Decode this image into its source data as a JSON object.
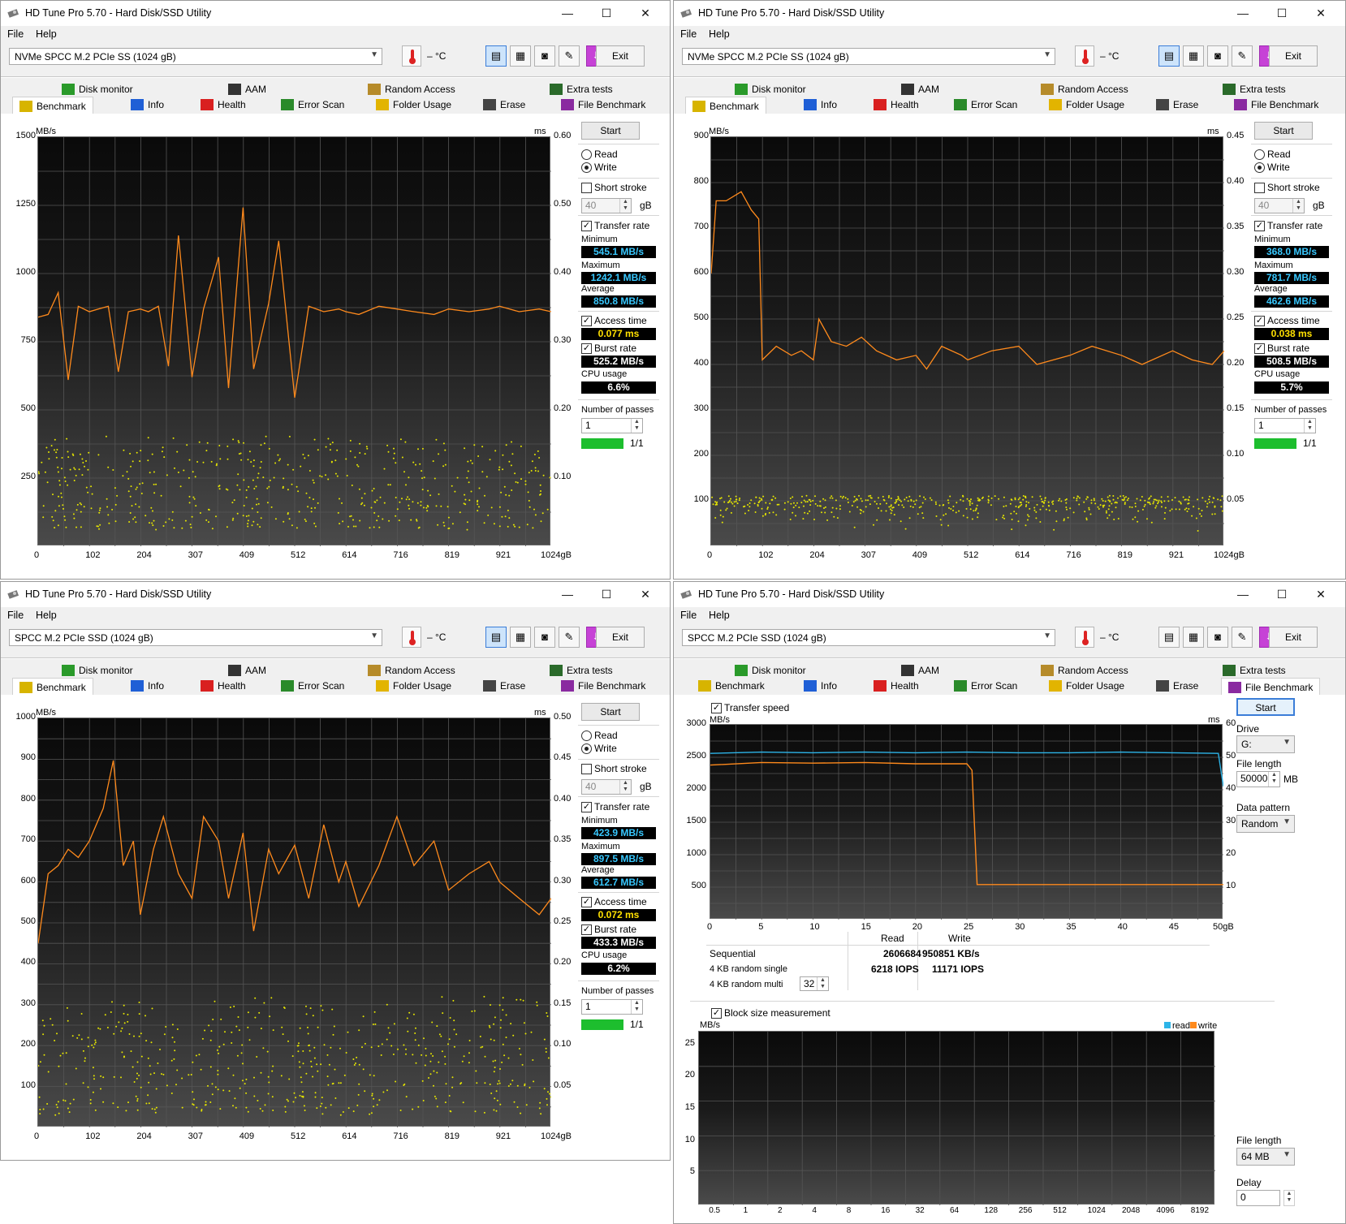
{
  "windows": [
    {
      "title": "HD Tune Pro 5.70 - Hard Disk/SSD Utility",
      "menu": [
        "File",
        "Help"
      ],
      "drive": "NVMe   SPCC M.2 PCIe SS (1024 gB)",
      "temp": "– °C",
      "exit": "Exit",
      "tabs_row1": [
        "Disk monitor",
        "AAM",
        "Random Access",
        "Extra tests"
      ],
      "tabs_row2": [
        "Benchmark",
        "Info",
        "Health",
        "Error Scan",
        "Folder Usage",
        "Erase",
        "File Benchmark"
      ],
      "active_tab": "Benchmark",
      "start": "Start",
      "read": "Read",
      "write": "Write",
      "mode": "write",
      "short_stroke": "Short stroke",
      "stroke_value": "40",
      "stroke_unit": "gB",
      "transfer_rate": "Transfer rate",
      "minimum_label": "Minimum",
      "minimum": "545.1 MB/s",
      "maximum_label": "Maximum",
      "maximum": "1242.1 MB/s",
      "average_label": "Average",
      "average": "850.8 MB/s",
      "access_time_label": "Access time",
      "access_time": "0.077 ms",
      "burst_rate_label": "Burst rate",
      "burst_rate": "525.2 MB/s",
      "cpu_usage_label": "CPU usage",
      "cpu_usage": "6.6%",
      "passes_label": "Number of passes",
      "passes": "1",
      "pass_progress": "1/1",
      "y_unit": "MB/s",
      "y2_unit": "ms",
      "y_ticks": [
        "1500",
        "1250",
        "1000",
        "750",
        "500",
        "250"
      ],
      "y2_ticks": [
        "0.60",
        "0.50",
        "0.40",
        "0.30",
        "0.20",
        "0.10"
      ],
      "x_ticks": [
        "0",
        "102",
        "204",
        "307",
        "409",
        "512",
        "614",
        "716",
        "819",
        "921",
        "1024gB"
      ]
    },
    {
      "title": "HD Tune Pro 5.70 - Hard Disk/SSD Utility",
      "menu": [
        "File",
        "Help"
      ],
      "drive": "NVMe   SPCC M.2 PCIe SS (1024 gB)",
      "temp": "– °C",
      "exit": "Exit",
      "tabs_row1": [
        "Disk monitor",
        "AAM",
        "Random Access",
        "Extra tests"
      ],
      "tabs_row2": [
        "Benchmark",
        "Info",
        "Health",
        "Error Scan",
        "Folder Usage",
        "Erase",
        "File Benchmark"
      ],
      "active_tab": "Benchmark",
      "start": "Start",
      "read": "Read",
      "write": "Write",
      "mode": "write",
      "short_stroke": "Short stroke",
      "stroke_value": "40",
      "stroke_unit": "gB",
      "transfer_rate": "Transfer rate",
      "minimum_label": "Minimum",
      "minimum": "368.0 MB/s",
      "maximum_label": "Maximum",
      "maximum": "781.7 MB/s",
      "average_label": "Average",
      "average": "462.6 MB/s",
      "access_time_label": "Access time",
      "access_time": "0.038 ms",
      "burst_rate_label": "Burst rate",
      "burst_rate": "508.5 MB/s",
      "cpu_usage_label": "CPU usage",
      "cpu_usage": "5.7%",
      "passes_label": "Number of passes",
      "passes": "1",
      "pass_progress": "1/1",
      "y_unit": "MB/s",
      "y2_unit": "ms",
      "y_ticks": [
        "900",
        "800",
        "700",
        "600",
        "500",
        "400",
        "300",
        "200",
        "100"
      ],
      "y2_ticks": [
        "0.45",
        "0.40",
        "0.35",
        "0.30",
        "0.25",
        "0.20",
        "0.15",
        "0.10",
        "0.05"
      ],
      "x_ticks": [
        "0",
        "102",
        "204",
        "307",
        "409",
        "512",
        "614",
        "716",
        "819",
        "921",
        "1024gB"
      ]
    },
    {
      "title": "HD Tune Pro 5.70 - Hard Disk/SSD Utility",
      "menu": [
        "File",
        "Help"
      ],
      "drive": "SPCC M.2 PCIe SSD (1024 gB)",
      "temp": "– °C",
      "exit": "Exit",
      "tabs_row1": [
        "Disk monitor",
        "AAM",
        "Random Access",
        "Extra tests"
      ],
      "tabs_row2": [
        "Benchmark",
        "Info",
        "Health",
        "Error Scan",
        "Folder Usage",
        "Erase",
        "File Benchmark"
      ],
      "active_tab": "Benchmark",
      "start": "Start",
      "read": "Read",
      "write": "Write",
      "mode": "write",
      "short_stroke": "Short stroke",
      "stroke_value": "40",
      "stroke_unit": "gB",
      "transfer_rate": "Transfer rate",
      "minimum_label": "Minimum",
      "minimum": "423.9 MB/s",
      "maximum_label": "Maximum",
      "maximum": "897.5 MB/s",
      "average_label": "Average",
      "average": "612.7 MB/s",
      "access_time_label": "Access time",
      "access_time": "0.072 ms",
      "burst_rate_label": "Burst rate",
      "burst_rate": "433.3 MB/s",
      "cpu_usage_label": "CPU usage",
      "cpu_usage": "6.2%",
      "passes_label": "Number of passes",
      "passes": "1",
      "pass_progress": "1/1",
      "y_unit": "MB/s",
      "y2_unit": "ms",
      "y_ticks": [
        "1000",
        "900",
        "800",
        "700",
        "600",
        "500",
        "400",
        "300",
        "200",
        "100"
      ],
      "y2_ticks": [
        "0.50",
        "0.45",
        "0.40",
        "0.35",
        "0.30",
        "0.25",
        "0.20",
        "0.15",
        "0.10",
        "0.05"
      ],
      "x_ticks": [
        "0",
        "102",
        "204",
        "307",
        "409",
        "512",
        "614",
        "716",
        "819",
        "921",
        "1024gB"
      ]
    },
    {
      "title": "HD Tune Pro 5.70 - Hard Disk/SSD Utility",
      "menu": [
        "File",
        "Help"
      ],
      "drive": "SPCC M.2 PCIe SSD (1024 gB)",
      "temp": "– °C",
      "exit": "Exit",
      "tabs_row1": [
        "Disk monitor",
        "AAM",
        "Random Access",
        "Extra tests"
      ],
      "tabs_row2": [
        "Benchmark",
        "Info",
        "Health",
        "Error Scan",
        "Folder Usage",
        "Erase",
        "File Benchmark"
      ],
      "active_tab": "File Benchmark",
      "start": "Start",
      "transfer_speed": "Transfer speed",
      "y_unit": "MB/s",
      "y2_unit": "ms",
      "y_ticks": [
        "3000",
        "2500",
        "2000",
        "1500",
        "1000",
        "500"
      ],
      "y2_ticks": [
        "60",
        "50",
        "40",
        "30",
        "20",
        "10"
      ],
      "x_ticks": [
        "0",
        "5",
        "10",
        "15",
        "20",
        "25",
        "30",
        "35",
        "40",
        "45",
        "50gB"
      ],
      "drive_label": "Drive",
      "drive_value": "G:",
      "file_length_label": "File length",
      "file_length_value": "50000",
      "file_length_unit": "MB",
      "data_pattern_label": "Data pattern",
      "data_pattern_value": "Random",
      "results_header_read": "Read",
      "results_header_write": "Write",
      "sequential_label": "Sequential",
      "sequential_read": "2606684",
      "sequential_write": "950851 KB/s",
      "random_single_label": "4 KB random single",
      "random_single_read": "6218 IOPS",
      "random_single_write": "11171 IOPS",
      "random_multi_label": "4 KB random multi",
      "random_multi_value": "32",
      "block_size": "Block size measurement",
      "bs_unit": "MB/s",
      "bs_y_ticks": [
        "25",
        "20",
        "15",
        "10",
        "5"
      ],
      "bs_x_ticks": [
        "0.5",
        "1",
        "2",
        "4",
        "8",
        "16",
        "32",
        "64",
        "128",
        "256",
        "512",
        "1024",
        "2048",
        "4096",
        "8192"
      ],
      "legend_read": "read",
      "legend_write": "write",
      "bs_file_length_label": "File length",
      "bs_file_length_value": "64 MB",
      "delay_label": "Delay",
      "delay_value": "0"
    }
  ],
  "colors": {
    "transfer_line": "#ff8a1c",
    "access_dots": "#e6e600",
    "read_line": "#2db4e8",
    "write_line": "#ff8a1c",
    "value_cyan": "#38c8ff",
    "value_yellow": "#ffe000",
    "progress_green": "#1dbe2e"
  },
  "chart_data": [
    {
      "type": "line",
      "x_unit": "gB",
      "ylim": [
        0,
        1500
      ],
      "y2lim": [
        0,
        0.6
      ],
      "xlim": [
        0,
        1024
      ],
      "series": [
        {
          "name": "Transfer rate",
          "x": [
            0,
            20,
            40,
            60,
            80,
            102,
            120,
            140,
            160,
            180,
            204,
            220,
            240,
            260,
            280,
            307,
            330,
            360,
            380,
            409,
            430,
            460,
            480,
            512,
            540,
            570,
            600,
            614,
            640,
            680,
            716,
            750,
            790,
            819,
            860,
            900,
            921,
            960,
            1000,
            1024
          ],
          "values": [
            840,
            850,
            930,
            610,
            880,
            860,
            870,
            880,
            640,
            860,
            870,
            860,
            880,
            660,
            1140,
            620,
            870,
            1060,
            580,
            1242,
            650,
            890,
            1120,
            545,
            880,
            860,
            870,
            860,
            850,
            880,
            870,
            860,
            850,
            870,
            860,
            870,
            880,
            860,
            870,
            860
          ]
        }
      ]
    },
    {
      "type": "line",
      "x_unit": "gB",
      "ylim": [
        0,
        900
      ],
      "y2lim": [
        0,
        0.45
      ],
      "xlim": [
        0,
        1024
      ],
      "series": [
        {
          "name": "Transfer rate",
          "x": [
            0,
            10,
            30,
            60,
            80,
            95,
            102,
            130,
            160,
            180,
            204,
            215,
            240,
            270,
            300,
            330,
            370,
            409,
            430,
            460,
            500,
            512,
            560,
            614,
            650,
            716,
            760,
            819,
            860,
            921,
            960,
            1000,
            1024
          ],
          "values": [
            600,
            760,
            760,
            780,
            740,
            720,
            410,
            440,
            420,
            430,
            410,
            500,
            450,
            440,
            460,
            430,
            410,
            420,
            390,
            440,
            420,
            410,
            430,
            440,
            400,
            420,
            440,
            420,
            400,
            430,
            410,
            400,
            430
          ]
        }
      ]
    },
    {
      "type": "line",
      "x_unit": "gB",
      "ylim": [
        0,
        1000
      ],
      "y2lim": [
        0,
        0.5
      ],
      "xlim": [
        0,
        1024
      ],
      "series": [
        {
          "name": "Transfer rate",
          "x": [
            0,
            20,
            40,
            60,
            80,
            102,
            130,
            150,
            170,
            190,
            204,
            230,
            250,
            280,
            307,
            330,
            360,
            380,
            409,
            430,
            460,
            480,
            512,
            540,
            570,
            600,
            614,
            640,
            680,
            716,
            750,
            790,
            819,
            860,
            900,
            921,
            960,
            1000,
            1024
          ],
          "values": [
            450,
            620,
            640,
            680,
            660,
            700,
            780,
            897,
            640,
            700,
            520,
            680,
            760,
            620,
            560,
            760,
            700,
            560,
            720,
            480,
            680,
            620,
            690,
            560,
            740,
            600,
            650,
            540,
            640,
            760,
            640,
            700,
            580,
            620,
            650,
            600,
            560,
            520,
            560
          ]
        }
      ]
    },
    {
      "type": "line",
      "x_unit": "gB",
      "ylim": [
        0,
        3000
      ],
      "xlim": [
        0,
        50
      ],
      "series": [
        {
          "name": "read",
          "x": [
            0,
            5,
            10,
            15,
            20,
            25,
            30,
            35,
            40,
            45,
            49.5,
            50
          ],
          "values": [
            2560,
            2580,
            2570,
            2580,
            2570,
            2580,
            2570,
            2570,
            2580,
            2570,
            2560,
            2050
          ]
        },
        {
          "name": "write",
          "x": [
            0,
            5,
            10,
            15,
            20,
            25,
            25.5,
            26,
            30,
            35,
            40,
            45,
            50
          ],
          "values": [
            2380,
            2420,
            2410,
            2420,
            2400,
            2400,
            2300,
            540,
            540,
            540,
            540,
            540,
            540
          ]
        }
      ]
    }
  ]
}
